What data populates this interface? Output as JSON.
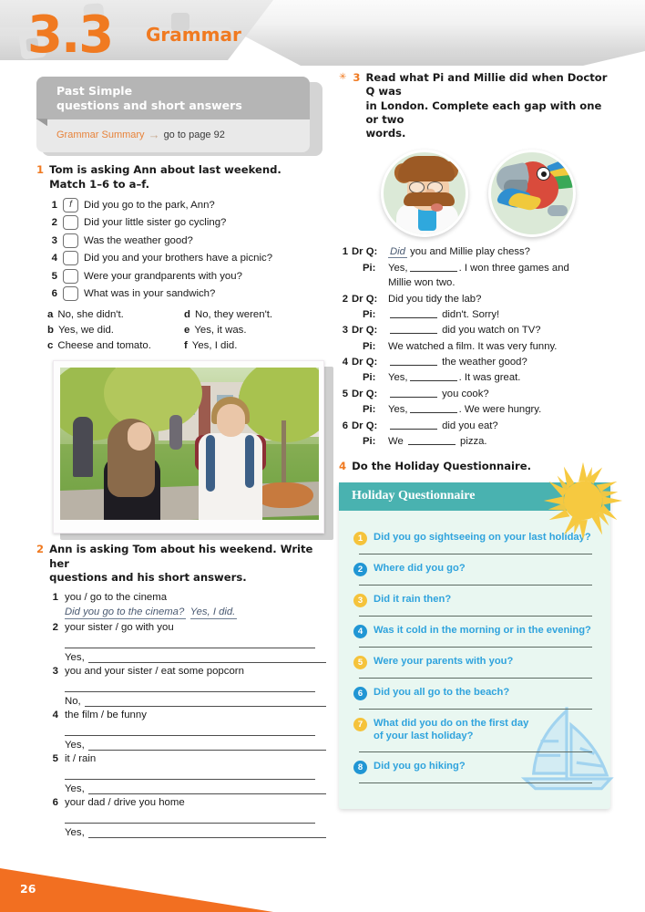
{
  "header": {
    "unit": "3.3",
    "section_title": "Grammar",
    "accent_orange": "#F07A21"
  },
  "grammar_box": {
    "title_line1": "Past Simple",
    "title_line2": "questions and short answers",
    "summary_label": "Grammar Summary",
    "arrow": "→",
    "page_ref": "go to page 92",
    "header_bg": "#b5b5b5",
    "body_bg": "#e9e9e9"
  },
  "exercise1": {
    "number": "1",
    "instruction_line1": "Tom is asking Ann about last weekend.",
    "instruction_line2": "Match 1–6 to a–f.",
    "questions": [
      {
        "num": "1",
        "answer": "f",
        "text": "Did you go to the park, Ann?"
      },
      {
        "num": "2",
        "answer": "",
        "text": "Did your little sister go cycling?"
      },
      {
        "num": "3",
        "answer": "",
        "text": "Was the weather good?"
      },
      {
        "num": "4",
        "answer": "",
        "text": "Did you and your brothers have a picnic?"
      },
      {
        "num": "5",
        "answer": "",
        "text": "Were your grandparents with you?"
      },
      {
        "num": "6",
        "answer": "",
        "text": "What was in your sandwich?"
      }
    ],
    "answers": [
      {
        "letter": "a",
        "text": "No, she didn't."
      },
      {
        "letter": "d",
        "text": "No, they weren't."
      },
      {
        "letter": "b",
        "text": "Yes, we did."
      },
      {
        "letter": "e",
        "text": "Yes, it was."
      },
      {
        "letter": "c",
        "text": "Cheese and tomato."
      },
      {
        "letter": "f",
        "text": "Yes, I did."
      }
    ]
  },
  "photo": {
    "caption": "",
    "alt": "Two teenagers walking outside a school building"
  },
  "exercise2": {
    "number": "2",
    "instruction_line1": "Ann is asking Tom about his weekend. Write her",
    "instruction_line2": "questions and his short answers.",
    "items": [
      {
        "num": "1",
        "prompt": "you / go to the cinema",
        "model_q": "Did you go to the cinema?",
        "model_a": "Yes, I did.",
        "answer_lead": ""
      },
      {
        "num": "2",
        "prompt": "your sister / go with you",
        "model_q": "",
        "model_a": "",
        "answer_lead": "Yes,"
      },
      {
        "num": "3",
        "prompt": "you and your sister / eat some popcorn",
        "model_q": "",
        "model_a": "",
        "answer_lead": "No,"
      },
      {
        "num": "4",
        "prompt": "the film / be funny",
        "model_q": "",
        "model_a": "",
        "answer_lead": "Yes,"
      },
      {
        "num": "5",
        "prompt": "it / rain",
        "model_q": "",
        "model_a": "",
        "answer_lead": "Yes,"
      },
      {
        "num": "6",
        "prompt": "your dad / drive you home",
        "model_q": "",
        "model_a": "",
        "answer_lead": "Yes,"
      }
    ]
  },
  "exercise3": {
    "star": "✳",
    "number": "3",
    "instruction_line1": "Read what Pi and Millie did when Doctor Q was",
    "instruction_line2": "in London. Complete each gap with one or two",
    "instruction_line3": "words.",
    "avatars": [
      {
        "name": "doctor-q-avatar",
        "label": "Doctor Q"
      },
      {
        "name": "pi-parrot-avatar",
        "label": "Pi"
      }
    ],
    "dialogue": [
      {
        "num": "1",
        "speaker": "Dr Q:",
        "pre_answer": "Did",
        "text": "you and Millie play chess?"
      },
      {
        "num": "",
        "speaker": "Pi:",
        "text_a": "Yes,",
        "text_b": ". I won three games and",
        "text_c": "Millie won two."
      },
      {
        "num": "2",
        "speaker": "Dr Q:",
        "text": "Did you tidy the lab?"
      },
      {
        "num": "",
        "speaker": "Pi:",
        "text_b": "didn't. Sorry!"
      },
      {
        "num": "3",
        "speaker": "Dr Q:",
        "text_b": "did you watch on TV?"
      },
      {
        "num": "",
        "speaker": "Pi:",
        "text": "We watched a film. It was very funny."
      },
      {
        "num": "4",
        "speaker": "Dr Q:",
        "text_b": "the weather good?"
      },
      {
        "num": "",
        "speaker": "Pi:",
        "text_a": "Yes,",
        "text_b": ". It was great."
      },
      {
        "num": "5",
        "speaker": "Dr Q:",
        "text_b": "you cook?"
      },
      {
        "num": "",
        "speaker": "Pi:",
        "text_a": "Yes,",
        "text_b": ". We were hungry."
      },
      {
        "num": "6",
        "speaker": "Dr Q:",
        "text_b": "did you eat?"
      },
      {
        "num": "",
        "speaker": "Pi:",
        "text_a": "We",
        "text_b": "pizza."
      }
    ]
  },
  "exercise4": {
    "number": "4",
    "instruction": "Do the Holiday Questionnaire."
  },
  "questionnaire": {
    "title": "Holiday Questionnaire",
    "header_color": "#49b2b0",
    "body_color": "#e9f7f1",
    "text_color": "#2fa3dd",
    "circle_yellow": "#f5c33b",
    "circle_blue": "#2196d4",
    "items": [
      {
        "num": "1",
        "color": "yellow",
        "text": "Did you go sightseeing on your last holiday?"
      },
      {
        "num": "2",
        "color": "blue",
        "text": "Where did you go?"
      },
      {
        "num": "3",
        "color": "yellow",
        "text": "Did it rain then?"
      },
      {
        "num": "4",
        "color": "blue",
        "text": "Was it cold in the morning or in the evening?"
      },
      {
        "num": "5",
        "color": "yellow",
        "text": "Were your parents with you?"
      },
      {
        "num": "6",
        "color": "blue",
        "text": "Did you all go to the beach?"
      },
      {
        "num": "7",
        "color": "yellow",
        "text": "What did you do on the first day of your last holiday?"
      },
      {
        "num": "8",
        "color": "blue",
        "text": "Did you go hiking?"
      }
    ]
  },
  "footer": {
    "page_number": "26",
    "bar_color": "#F26F21"
  }
}
